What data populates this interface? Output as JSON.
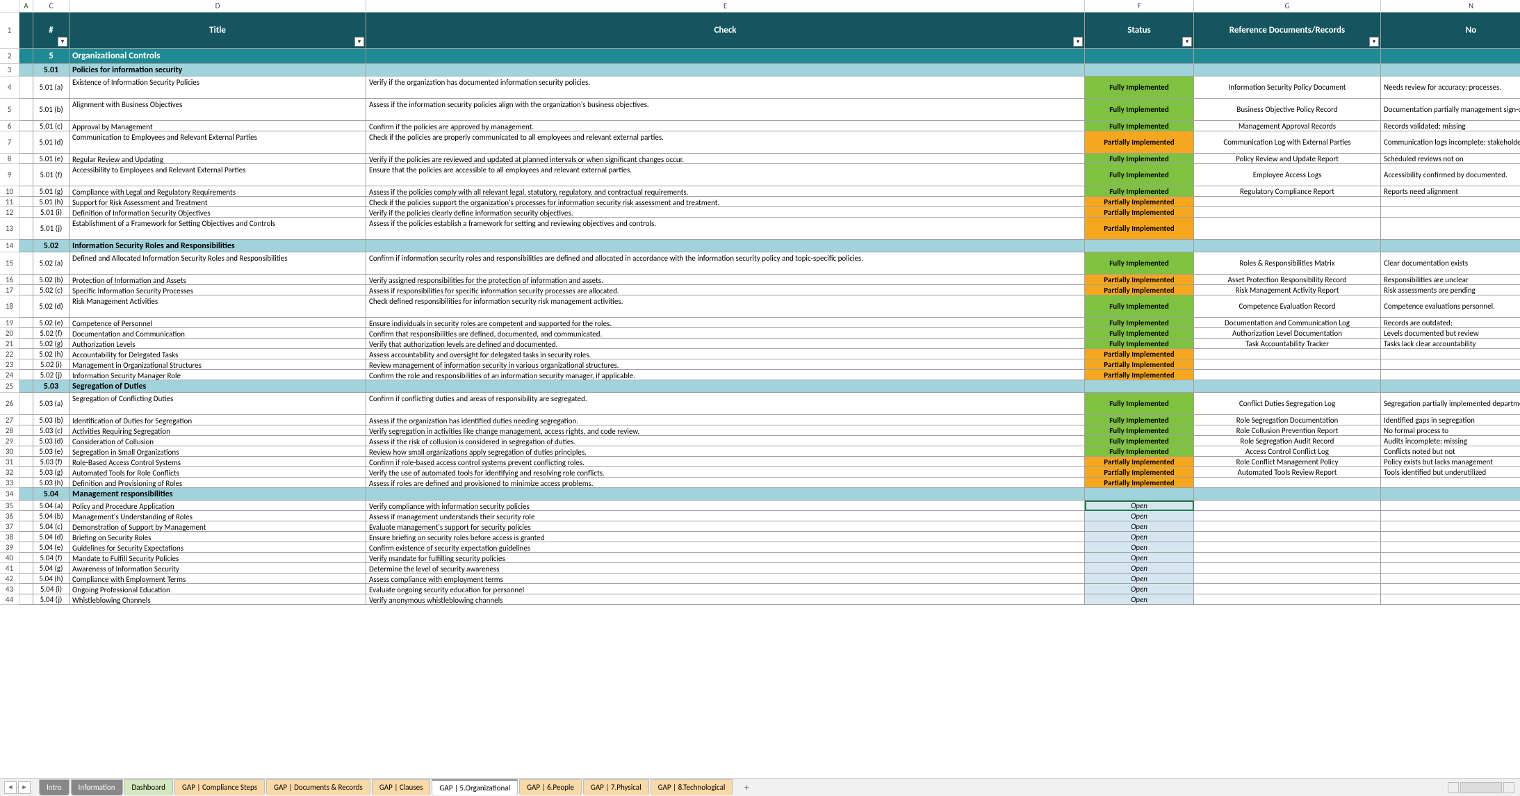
{
  "columns": {
    "A": "A",
    "C": "C",
    "D": "D",
    "E": "E",
    "F": "F",
    "G": "G",
    "N": "N"
  },
  "headers": {
    "num": "#",
    "title": "Title",
    "check": "Check",
    "status": "Status",
    "ref": "Reference Documents/Records",
    "no": "No"
  },
  "section": {
    "num": "5",
    "title": "Organizational Controls"
  },
  "status_labels": {
    "full": "Fully Implemented",
    "part": "Partially Implemented",
    "open": "Open"
  },
  "groups": [
    {
      "num": "5.01",
      "title": "Policies for information security",
      "rows": [
        {
          "r": 4,
          "id": "5.01 (a)",
          "t": "Existence of Information Security Policies",
          "c": "Verify if the organization has documented information security policies.",
          "s": "full",
          "g": "Information Security Policy Document",
          "n": "Needs review for accuracy; processes.",
          "tall": true
        },
        {
          "r": 5,
          "id": "5.01 (b)",
          "t": "Alignment with Business Objectives",
          "c": "Assess if the information security policies align with the organization's business objectives.",
          "s": "full",
          "g": "Business Objective Policy Record",
          "n": "Documentation partially management sign-off.",
          "tall": true
        },
        {
          "r": 6,
          "id": "5.01 (c)",
          "t": "Approval by Management",
          "c": "Confirm if the policies are approved by management.",
          "s": "full",
          "g": "Management Approval Records",
          "n": "Records validated; missing"
        },
        {
          "r": 7,
          "id": "5.01 (d)",
          "t": "Communication to Employees and Relevant External Parties",
          "c": "Check if the policies are properly communicated to all employees and relevant external parties.",
          "s": "part",
          "g": "Communication Log with External Parties",
          "n": "Communication logs incomplete; stakeholders.",
          "tall": true
        },
        {
          "r": 8,
          "id": "5.01 (e)",
          "t": "Regular Review and Updating",
          "c": "Verify if the policies are reviewed and updated at planned intervals or when significant changes occur.",
          "s": "full",
          "g": "Policy Review and Update Report",
          "n": "Scheduled reviews not on"
        },
        {
          "r": 9,
          "id": "5.01 (f)",
          "t": "Accessibility to Employees and Relevant External Parties",
          "c": "Ensure that the policies are accessible to all employees and relevant external parties.",
          "s": "full",
          "g": "Employee Access Logs",
          "n": "Accessibility confirmed by documented.",
          "tall": true
        },
        {
          "r": 10,
          "id": "5.01 (g)",
          "t": "Compliance with Legal and Regulatory Requirements",
          "c": "Assess if the policies comply with all relevant legal, statutory, regulatory, and contractual requirements.",
          "s": "full",
          "g": "Regulatory Compliance Report",
          "n": "Reports need alignment"
        },
        {
          "r": 11,
          "id": "5.01 (h)",
          "t": "Support for Risk Assessment and Treatment",
          "c": "Check if the policies support the organization's processes for information security risk assessment and treatment.",
          "s": "part",
          "g": "",
          "n": ""
        },
        {
          "r": 12,
          "id": "5.01 (i)",
          "t": "Definition of Information Security Objectives",
          "c": "Verify if the policies clearly define information security objectives.",
          "s": "part",
          "g": "",
          "n": ""
        },
        {
          "r": 13,
          "id": "5.01 (j)",
          "t": "Establishment of a Framework for Setting Objectives and Controls",
          "c": "Assess if the policies establish a framework for setting and reviewing objectives and controls.",
          "s": "part",
          "g": "",
          "n": "",
          "tall": true
        }
      ]
    },
    {
      "num": "5.02",
      "title": "Information Security Roles and Responsibilities",
      "rows": [
        {
          "r": 15,
          "id": "5.02 (a)",
          "t": "Defined and Allocated Information Security Roles and Responsibilities",
          "c": "Confirm if information security roles and responsibilities are defined and allocated in accordance with the information security policy and topic-specific policies.",
          "s": "full",
          "g": "Roles & Responsibilities Matrix",
          "n": "Clear documentation exists",
          "tall": true
        },
        {
          "r": 16,
          "id": "5.02 (b)",
          "t": "Protection of Information and Assets",
          "c": "Verify assigned responsibilities for the protection of information and assets.",
          "s": "part",
          "g": "Asset Protection Responsibility Record",
          "n": "Responsibilities are unclear"
        },
        {
          "r": 17,
          "id": "5.02 (c)",
          "t": "Specific Information Security Processes",
          "c": "Assess if responsibilities for specific information security processes are allocated.",
          "s": "part",
          "g": "Risk Management Activity Report",
          "n": "Risk assessments are pending"
        },
        {
          "r": 18,
          "id": "5.02 (d)",
          "t": "Risk Management Activities",
          "c": "Check defined responsibilities for information security risk management activities.",
          "s": "full",
          "g": "Competence Evaluation Record",
          "n": "Competence evaluations personnel.",
          "tall": true
        },
        {
          "r": 19,
          "id": "5.02 (e)",
          "t": "Competence of Personnel",
          "c": "Ensure individuals in security roles are competent and supported for the roles.",
          "s": "full",
          "g": "Documentation and Communication Log",
          "n": "Records are outdated;"
        },
        {
          "r": 20,
          "id": "5.02 (f)",
          "t": "Documentation and Communication",
          "c": "Confirm that responsibilities are defined, documented, and communicated.",
          "s": "full",
          "g": "Authorization Level Documentation",
          "n": "Levels documented but review"
        },
        {
          "r": 21,
          "id": "5.02 (g)",
          "t": "Authorization Levels",
          "c": "Verify that authorization levels are defined and documented.",
          "s": "full",
          "g": "Task Accountability Tracker",
          "n": "Tasks lack clear accountability"
        },
        {
          "r": 22,
          "id": "5.02 (h)",
          "t": "Accountability for Delegated Tasks",
          "c": "Assess accountability and oversight for delegated tasks in security roles.",
          "s": "part",
          "g": "",
          "n": ""
        },
        {
          "r": 23,
          "id": "5.02 (i)",
          "t": "Management in Organizational Structures",
          "c": "Review management of information security in various organizational structures.",
          "s": "part",
          "g": "",
          "n": ""
        },
        {
          "r": 24,
          "id": "5.02 (j)",
          "t": "Information Security Manager Role",
          "c": "Confirm the role and responsibilities of an information security manager, if applicable.",
          "s": "part",
          "g": "",
          "n": ""
        }
      ]
    },
    {
      "num": "5.03",
      "title": "Segregation of Duties",
      "rows": [
        {
          "r": 26,
          "id": "5.03 (a)",
          "t": "Segregation of Conflicting Duties",
          "c": "Confirm if conflicting duties and areas of responsibility are segregated.",
          "s": "full",
          "g": "Conflict Duties Segregation Log",
          "n": "Segregation partially implemented departments.",
          "tall": true
        },
        {
          "r": 27,
          "id": "5.03 (b)",
          "t": "Identification of Duties for Segregation",
          "c": "Assess if the organization has identified duties needing segregation.",
          "s": "full",
          "g": "Role Segregation Documentation",
          "n": "Identified gaps in segregation"
        },
        {
          "r": 28,
          "id": "5.03 (c)",
          "t": "Activities Requiring Segregation",
          "c": "Verify segregation in activities like change management, access rights, and code review.",
          "s": "full",
          "g": "Role Collusion Prevention Report",
          "n": "No formal process to"
        },
        {
          "r": 29,
          "id": "5.03 (d)",
          "t": "Consideration of Collusion",
          "c": "Assess if the risk of collusion is considered in segregation of duties.",
          "s": "full",
          "g": "Role Segregation Audit Record",
          "n": "Audits incomplete; missing"
        },
        {
          "r": 30,
          "id": "5.03 (e)",
          "t": "Segregation in Small Organizations",
          "c": "Review how small organizations apply segregation of duties principles.",
          "s": "full",
          "g": "Access Control Conflict Log",
          "n": "Conflicts noted but not"
        },
        {
          "r": 31,
          "id": "5.03 (f)",
          "t": "Role-Based Access Control Systems",
          "c": "Confirm if role-based access control systems prevent conflicting roles.",
          "s": "part",
          "g": "Role Conflict Management Policy",
          "n": "Policy exists but lacks management"
        },
        {
          "r": 32,
          "id": "5.03 (g)",
          "t": "Automated Tools for Role Conflicts",
          "c": "Verify the use of automated tools for identifying and resolving role conflicts.",
          "s": "part",
          "g": "Automated Tools Review Report",
          "n": "Tools identified but underutilized"
        },
        {
          "r": 33,
          "id": "5.03 (h)",
          "t": "Definition and Provisioning of Roles",
          "c": "Assess if roles are defined and provisioned to minimize access problems.",
          "s": "part",
          "g": "",
          "n": ""
        }
      ]
    },
    {
      "num": "5.04",
      "title": "Management responsibilities",
      "rows": [
        {
          "r": 35,
          "id": "5.04 (a)",
          "t": "Policy and Procedure Application",
          "c": "Verify compliance with information security policies",
          "s": "open",
          "g": "",
          "n": "",
          "sel": true
        },
        {
          "r": 36,
          "id": "5.04 (b)",
          "t": "Management's Understanding of Roles",
          "c": "Assess if management understands their security role",
          "s": "open",
          "g": "",
          "n": ""
        },
        {
          "r": 37,
          "id": "5.04 (c)",
          "t": "Demonstration of Support by Management",
          "c": "Evaluate management's support for security policies",
          "s": "open",
          "g": "",
          "n": ""
        },
        {
          "r": 38,
          "id": "5.04 (d)",
          "t": "Briefing on Security Roles",
          "c": "Ensure briefing on security roles before access is granted",
          "s": "open",
          "g": "",
          "n": ""
        },
        {
          "r": 39,
          "id": "5.04 (e)",
          "t": "Guidelines for Security Expectations",
          "c": "Confirm existence of security expectation guidelines",
          "s": "open",
          "g": "",
          "n": ""
        },
        {
          "r": 40,
          "id": "5.04 (f)",
          "t": "Mandate to Fulfill Security Policies",
          "c": "Verify mandate for fulfilling security policies",
          "s": "open",
          "g": "",
          "n": ""
        },
        {
          "r": 41,
          "id": "5.04 (g)",
          "t": "Awareness of Information Security",
          "c": "Determine the level of security awareness",
          "s": "open",
          "g": "",
          "n": ""
        },
        {
          "r": 42,
          "id": "5.04 (h)",
          "t": "Compliance with Employment Terms",
          "c": "Assess compliance with employment terms",
          "s": "open",
          "g": "",
          "n": ""
        },
        {
          "r": 43,
          "id": "5.04 (i)",
          "t": "Ongoing Professional Education",
          "c": "Evaluate ongoing security education for personnel",
          "s": "open",
          "g": "",
          "n": ""
        },
        {
          "r": 44,
          "id": "5.04 (j)",
          "t": "Whistleblowing Channels",
          "c": "Verify anonymous whistleblowing channels",
          "s": "open",
          "g": "",
          "n": ""
        }
      ]
    }
  ],
  "tabs": [
    {
      "label": "Intro",
      "cls": "c1"
    },
    {
      "label": "Information",
      "cls": "c1"
    },
    {
      "label": "Dashboard",
      "cls": "c2"
    },
    {
      "label": "GAP | Compliance Steps",
      "cls": "c3"
    },
    {
      "label": "GAP | Documents & Records",
      "cls": "c3"
    },
    {
      "label": "GAP | Clauses",
      "cls": "c3"
    },
    {
      "label": "GAP | 5.Organizational",
      "cls": "active"
    },
    {
      "label": "GAP | 6.People",
      "cls": "c3"
    },
    {
      "label": "GAP | 7.Physical",
      "cls": "c3"
    },
    {
      "label": "GAP | 8.Technological",
      "cls": "c3"
    }
  ]
}
